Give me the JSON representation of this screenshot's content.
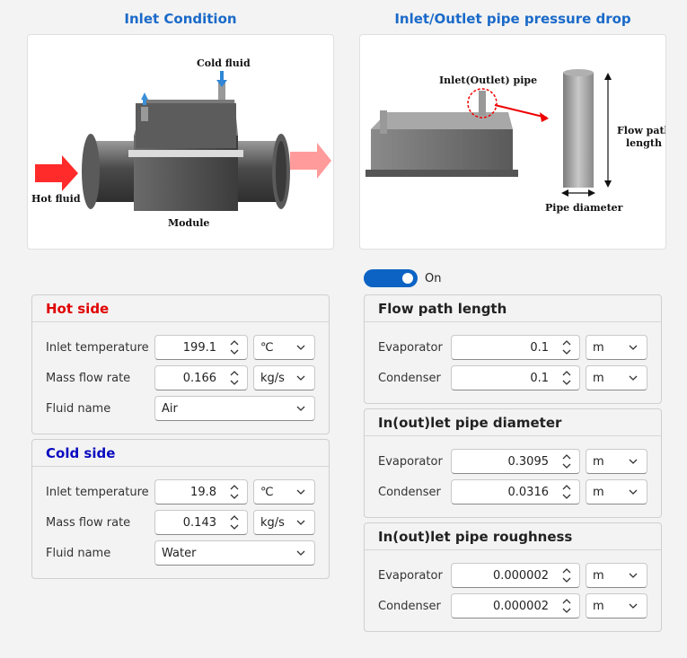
{
  "left_title": "Inlet Condition",
  "right_title": "Inlet/Outlet pipe pressure drop",
  "left_image": {
    "cold_fluid": "Cold fluid",
    "hot_fluid": "Hot fluid",
    "module": "Module"
  },
  "right_image": {
    "pipe": "Inlet(Outlet) pipe",
    "flow_path_line1": "Flow path",
    "flow_path_line2": "length",
    "pipe_diameter": "Pipe diameter"
  },
  "toggle": {
    "label": "On",
    "state": "on"
  },
  "hot_side": {
    "title": "Hot side",
    "inlet_temperature": {
      "label": "Inlet temperature",
      "value": "199.1",
      "unit": "℃"
    },
    "mass_flow_rate": {
      "label": "Mass flow rate",
      "value": "0.166",
      "unit": "kg/s"
    },
    "fluid_name": {
      "label": "Fluid name",
      "value": "Air"
    }
  },
  "cold_side": {
    "title": "Cold side",
    "inlet_temperature": {
      "label": "Inlet temperature",
      "value": "19.8",
      "unit": "℃"
    },
    "mass_flow_rate": {
      "label": "Mass flow rate",
      "value": "0.143",
      "unit": "kg/s"
    },
    "fluid_name": {
      "label": "Fluid name",
      "value": "Water"
    }
  },
  "flow_path_length": {
    "title": "Flow path length",
    "evaporator": {
      "label": "Evaporator",
      "value": "0.1",
      "unit": "m"
    },
    "condenser": {
      "label": "Condenser",
      "value": "0.1",
      "unit": "m"
    }
  },
  "pipe_diameter": {
    "title": "In(out)let pipe diameter",
    "evaporator": {
      "label": "Evaporator",
      "value": "0.3095",
      "unit": "m"
    },
    "condenser": {
      "label": "Condenser",
      "value": "0.0316",
      "unit": "m"
    }
  },
  "pipe_roughness": {
    "title": "In(out)let pipe roughness",
    "evaporator": {
      "label": "Evaporator",
      "value": "0.000002",
      "unit": "m"
    },
    "condenser": {
      "label": "Condenser",
      "value": "0.000002",
      "unit": "m"
    }
  },
  "colors": {
    "accent": "#1a6ac9",
    "hot": "#e00000",
    "cold": "#0a0ac0",
    "toggle": "#0c63c4"
  }
}
